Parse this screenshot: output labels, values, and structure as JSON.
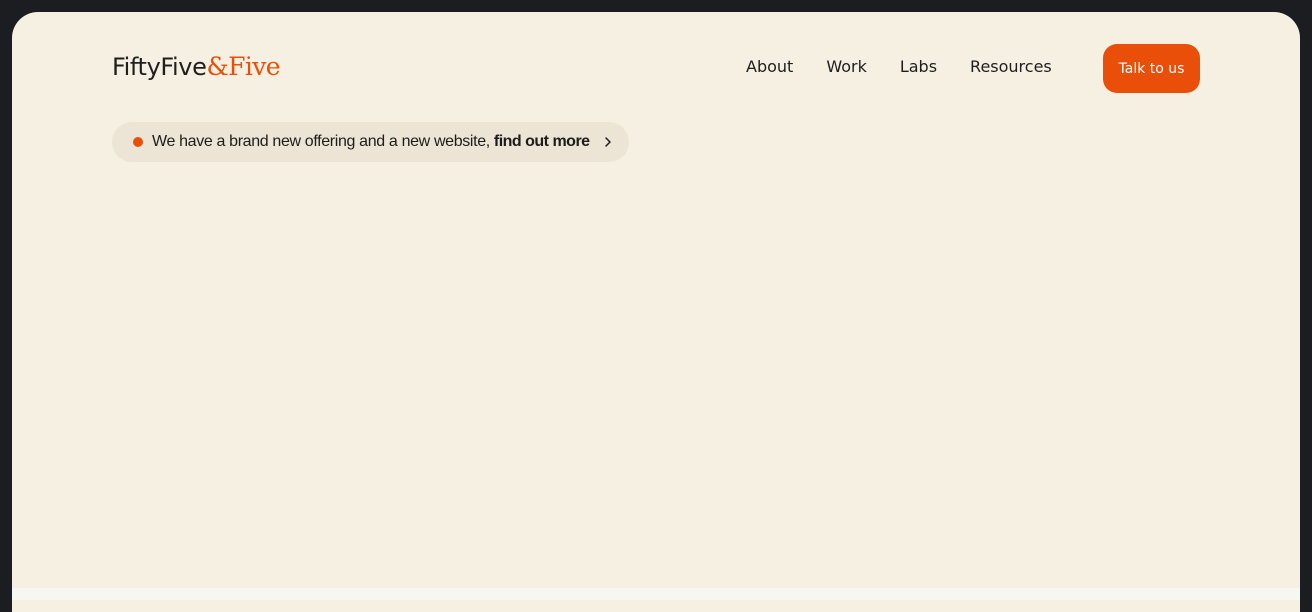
{
  "header": {
    "logo": {
      "main": "FiftyFive",
      "accent": "&Five"
    },
    "nav": [
      {
        "label": "About"
      },
      {
        "label": "Work"
      },
      {
        "label": "Labs"
      },
      {
        "label": "Resources"
      }
    ],
    "cta_label": "Talk to us"
  },
  "announcement": {
    "text": "We have a brand new offering and a new website,",
    "link_text": "find out more",
    "icon": "chevron-right-icon"
  },
  "colors": {
    "page_background": "#f5f0e1",
    "outer_background": "#1b1d20",
    "accent": "#ea4f0a",
    "text": "#1e1e1e",
    "pill_background": "#ece5d5"
  }
}
